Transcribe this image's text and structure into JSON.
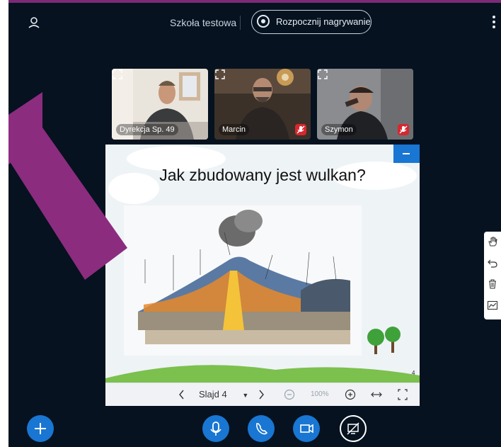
{
  "header": {
    "room_title": "Szkoła testowa",
    "record_label": "Rozpocznij nagrywanie"
  },
  "webcams": [
    {
      "name": "Dyrekcja Sp. 49",
      "muted": false
    },
    {
      "name": "Marcin",
      "muted": true
    },
    {
      "name": "Szymon",
      "muted": true
    }
  ],
  "slide": {
    "title": "Jak zbudowany jest wulkan?",
    "page_number": "4"
  },
  "slide_toolbar": {
    "current_slide": "Slajd 4",
    "zoom": "100%"
  },
  "colors": {
    "background": "#06121f",
    "accent": "#1976d2",
    "arrow": "#7b2a78"
  }
}
